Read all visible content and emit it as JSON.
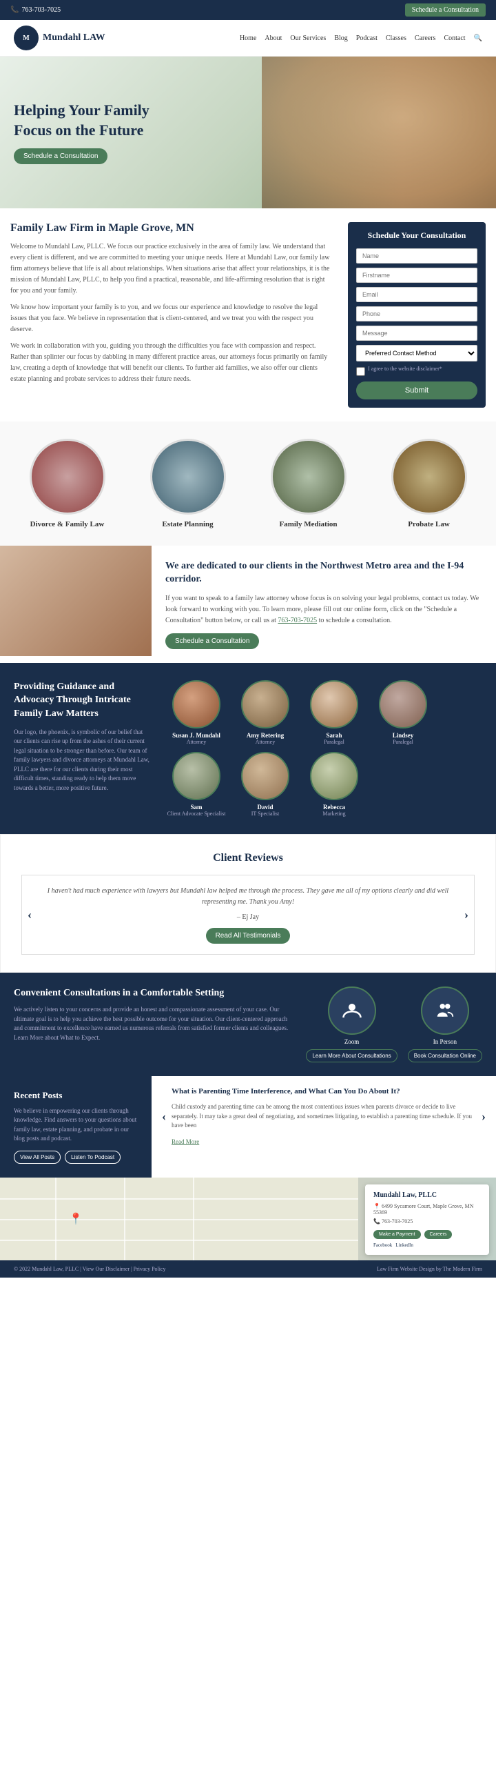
{
  "topbar": {
    "phone": "763-703-7025",
    "cta": "Schedule a Consultation"
  },
  "nav": {
    "logo_text": "Mundahl LAW",
    "links": [
      "Home",
      "About",
      "Our Services",
      "Blog",
      "Podcast",
      "Classes",
      "Careers",
      "Contact"
    ]
  },
  "hero": {
    "heading": "Helping Your Family Focus on the Future",
    "cta": "Schedule a Consultation"
  },
  "main": {
    "heading": "Family Law Firm in Maple Grove, MN",
    "p1": "Welcome to Mundahl Law, PLLC. We focus our practice exclusively in the area of family law. We understand that every client is different, and we are committed to meeting your unique needs. Here at Mundahl Law, our family law firm attorneys believe that life is all about relationships. When situations arise that affect your relationships, it is the mission of Mundahl Law, PLLC, to help you find a practical, reasonable, and life-affirming resolution that is right for you and your family.",
    "p2": "We know how important your family is to you, and we focus our experience and knowledge to resolve the legal issues that you face. We believe in representation that is client-centered, and we treat you with the respect you deserve.",
    "p3": "We work in collaboration with you, guiding you through the difficulties you face with compassion and respect. Rather than splinter our focus by dabbling in many different practice areas, our attorneys focus primarily on family law, creating a depth of knowledge that will benefit our clients. To further aid families, we also offer our clients estate planning and probate services to address their future needs."
  },
  "form": {
    "title": "Schedule Your Consultation",
    "name_placeholder": "Name",
    "firstname_placeholder": "Firstname",
    "email_placeholder": "Email",
    "phone_placeholder": "Phone",
    "message_placeholder": "Message",
    "contact_method": "Preferred Contact Method",
    "disclaimer": "I agree to the website disclaimer*",
    "submit": "Submit"
  },
  "services": {
    "items": [
      {
        "label": "Divorce & Family Law",
        "type": "divorce"
      },
      {
        "label": "Estate Planning",
        "type": "estate"
      },
      {
        "label": "Family Mediation",
        "type": "mediation"
      },
      {
        "label": "Probate Law",
        "type": "probate"
      }
    ]
  },
  "dedication": {
    "heading": "We are dedicated to our clients in the Northwest Metro area and the I-94 corridor.",
    "text": "If you want to speak to a family law attorney whose focus is on solving your legal problems, contact us today. We look forward to working with you. To learn more, please fill out our online form, click on the \"Schedule a Consultation\" button below, or call us at 763-703-7025 to schedule a consultation.",
    "phone": "763-703-7025",
    "cta": "Schedule a Consultation"
  },
  "team": {
    "heading": "Providing Guidance and Advocacy Through Intricate Family Law Matters",
    "text": "Our logo, the phoenix, is symbolic of our belief that our clients can rise up from the ashes of their current legal situation to be stronger than before. Our team of family lawyers and divorce attorneys at Mundahl Law, PLLC are there for our clients during their most difficult times, standing ready to help them move towards a better, more positive future.",
    "members": [
      {
        "name": "Susan J. Mundahl",
        "role": "Attorney"
      },
      {
        "name": "Amy Retering",
        "role": "Attorney"
      },
      {
        "name": "Sarah",
        "role": "Paralegal"
      },
      {
        "name": "Lindsey",
        "role": "Paralegal"
      },
      {
        "name": "Sam",
        "role": "Client Advocate Specialist"
      },
      {
        "name": "David",
        "role": "IT Specialist"
      },
      {
        "name": "Rebecca",
        "role": "Marketing"
      }
    ]
  },
  "reviews": {
    "heading": "Client Reviews",
    "review_text": "I haven't had much experience with lawyers but Mundahl law helped me through the process. They gave me all of my options clearly and did well representing me. Thank you Amy!",
    "reviewer": "– Ej Jay",
    "cta": "Read All Testimonials"
  },
  "consultations": {
    "heading": "Convenient Consultations in a Comfortable Setting",
    "text": "We actively listen to your concerns and provide an honest and compassionate assessment of your case. Our ultimate goal is to help you achieve the best possible outcome for your situation. Our client-centered approach and commitment to excellence have earned us numerous referrals from satisfied former clients and colleagues. Learn More about What to Expect.",
    "options": [
      {
        "label": "Zoom",
        "btn": "Learn More About Consultations"
      },
      {
        "label": "In Person",
        "btn": "Book Consultation Online"
      }
    ]
  },
  "posts": {
    "heading": "Recent Posts",
    "text": "We believe in empowering our clients through knowledge. Find answers to your questions about family law, estate planning, and probate in our blog posts and podcast.",
    "btn1": "View All Posts",
    "btn2": "Listen To Podcast",
    "post_title": "What is Parenting Time Interference, and What Can You Do About It?",
    "post_excerpt": "Child custody and parenting time can be among the most contentious issues when parents divorce or decide to live separately. It may take a great deal of negotiating, and sometimes litigating, to establish a parenting time schedule. If you have been",
    "read_more": "Read More"
  },
  "footer": {
    "firm": "Mundahl Law, PLLC",
    "address": "6499 Sycamore Court, Maple Grove, MN 55369",
    "phone": "763-703-7025",
    "payment_btn": "Make a Payment",
    "careers_btn": "Careers",
    "social1": "Facebook",
    "social2": "LinkedIn"
  },
  "bottom_footer": {
    "copyright": "© 2022 Mundahl Law, PLLC | View Our Disclaimer | Privacy Policy",
    "credit": "Law Firm Website Design by The Modern Firm"
  }
}
